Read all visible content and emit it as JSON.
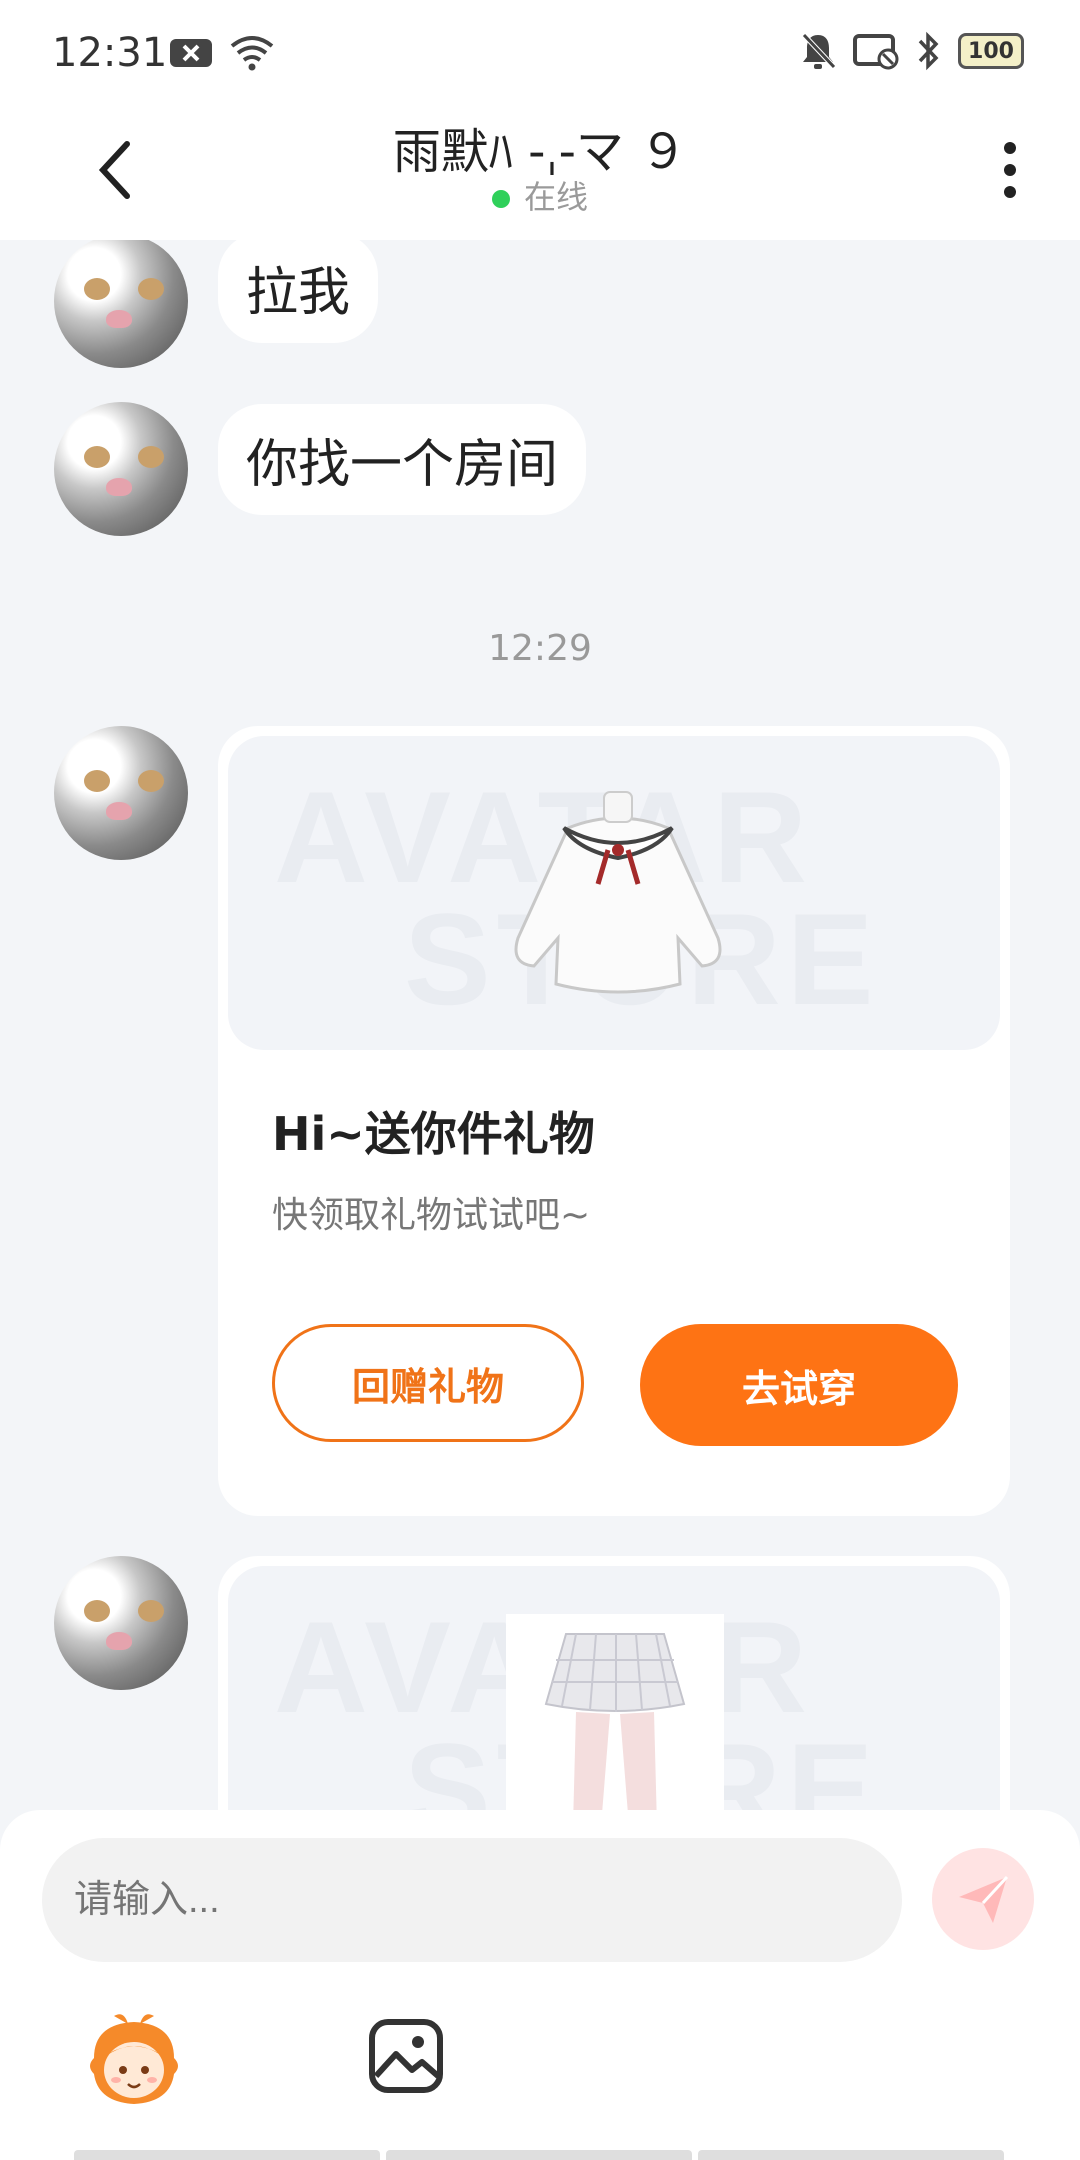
{
  "status_bar": {
    "time": "12:31",
    "battery": "100",
    "icons": [
      "notification-x-icon",
      "wifi-icon",
      "mute-bell-icon",
      "cast-off-icon",
      "bluetooth-icon",
      "battery-icon"
    ]
  },
  "header": {
    "title": "雨默ﾊ -ˌ-マ ９",
    "status": "在线",
    "status_color": "#2fd05a"
  },
  "messages": [
    {
      "type": "text",
      "text": "拉我"
    },
    {
      "type": "text",
      "text": "你找一个房间"
    },
    {
      "type": "time",
      "text": "12:29"
    },
    {
      "type": "gift_card",
      "image": "white-sailor-collar-sweater",
      "watermark": [
        "AVATAR",
        "STORE"
      ],
      "title": "Hi~送你件礼物",
      "subtitle": "快领取礼物试试吧~",
      "secondary_button": "回赠礼物",
      "primary_button": "去试穿"
    },
    {
      "type": "gift_card",
      "image": "plaid-skirt-stockings",
      "watermark": [
        "AVATAR",
        "STORE"
      ]
    }
  ],
  "input": {
    "placeholder": "请输入..."
  },
  "toolbar": {
    "items": [
      "character-avatar-icon",
      "image-icon"
    ]
  },
  "colors": {
    "accent": "#fe7314",
    "background": "#f3f5f8"
  }
}
